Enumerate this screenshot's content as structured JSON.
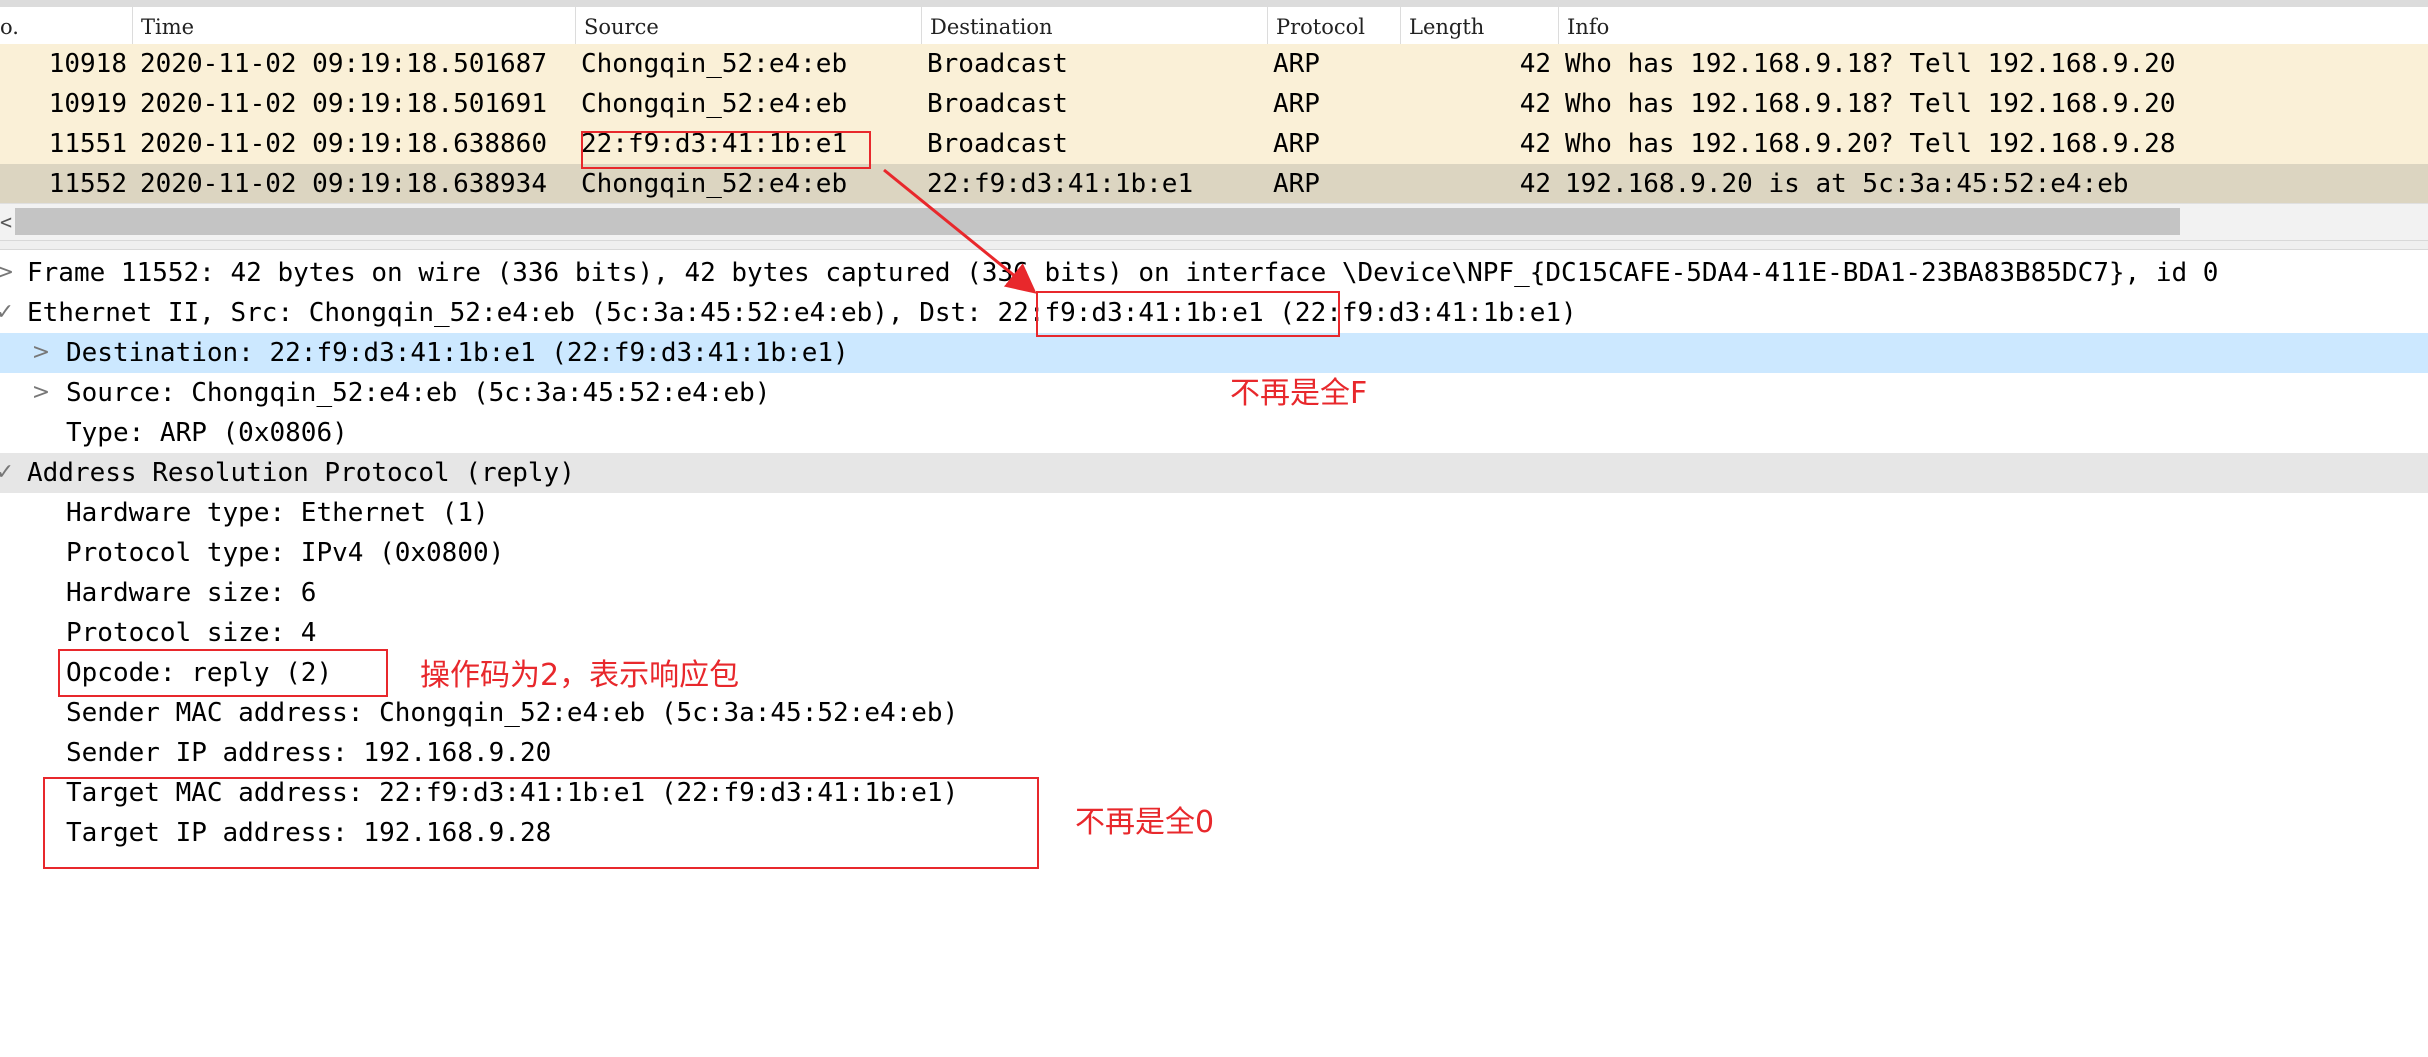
{
  "packet_list": {
    "columns": [
      "o.",
      "Time",
      "Source",
      "Destination",
      "Protocol",
      "Length",
      "Info"
    ],
    "rows": [
      {
        "no": "10918",
        "time": "2020-11-02 09:19:18.501687",
        "source": "Chongqin_52:e4:eb",
        "destination": "Broadcast",
        "protocol": "ARP",
        "length": "42",
        "info": "Who has 192.168.9.18? Tell 192.168.9.20"
      },
      {
        "no": "10919",
        "time": "2020-11-02 09:19:18.501691",
        "source": "Chongqin_52:e4:eb",
        "destination": "Broadcast",
        "protocol": "ARP",
        "length": "42",
        "info": "Who has 192.168.9.18? Tell 192.168.9.20"
      },
      {
        "no": "11551",
        "time": "2020-11-02 09:19:18.638860",
        "source": "22:f9:d3:41:1b:e1",
        "destination": "Broadcast",
        "protocol": "ARP",
        "length": "42",
        "info": "Who has 192.168.9.20? Tell 192.168.9.28"
      },
      {
        "no": "11552",
        "time": "2020-11-02 09:19:18.638934",
        "source": "Chongqin_52:e4:eb",
        "destination": "22:f9:d3:41:1b:e1",
        "protocol": "ARP",
        "length": "42",
        "info": "192.168.9.20 is at 5c:3a:45:52:e4:eb"
      }
    ],
    "scroll_left_glyph": "<"
  },
  "details": {
    "lines": [
      {
        "text": "Frame 11552: 42 bytes on wire (336 bits), 42 bytes captured (336 bits) on interface \\Device\\NPF_{DC15CAFE-5DA4-411E-BDA1-23BA83B85DC7}, id 0",
        "arrow": ">"
      },
      {
        "text": "Ethernet II, Src: Chongqin_52:e4:eb (5c:3a:45:52:e4:eb), Dst: 22:f9:d3:41:1b:e1 (22:f9:d3:41:1b:e1)",
        "arrow": "✓"
      },
      {
        "text": "Destination: 22:f9:d3:41:1b:e1 (22:f9:d3:41:1b:e1)",
        "arrow": ">"
      },
      {
        "text": "Source: Chongqin_52:e4:eb (5c:3a:45:52:e4:eb)",
        "arrow": ">"
      },
      {
        "text": "Type: ARP (0x0806)",
        "arrow": ""
      },
      {
        "text": "Address Resolution Protocol (reply)",
        "arrow": "✓"
      },
      {
        "text": "Hardware type: Ethernet (1)",
        "arrow": ""
      },
      {
        "text": "Protocol type: IPv4 (0x0800)",
        "arrow": ""
      },
      {
        "text": "Hardware size: 6",
        "arrow": ""
      },
      {
        "text": "Protocol size: 4",
        "arrow": ""
      },
      {
        "text": "Opcode: reply (2)",
        "arrow": ""
      },
      {
        "text": "Sender MAC address: Chongqin_52:e4:eb (5c:3a:45:52:e4:eb)",
        "arrow": ""
      },
      {
        "text": "Sender IP address: 192.168.9.20",
        "arrow": ""
      },
      {
        "text": "Target MAC address: 22:f9:d3:41:1b:e1 (22:f9:d3:41:1b:e1)",
        "arrow": ""
      },
      {
        "text": "Target IP address: 192.168.9.28",
        "arrow": ""
      }
    ]
  },
  "annotations": {
    "not_all_f": "不再是全F",
    "opcode_note": "操作码为2，表示响应包",
    "not_all_zero": "不再是全0"
  },
  "colors": {
    "row_bg": "#faf0d7",
    "row_selected_bg": "#dcd5c1",
    "detail_selected_bg": "#cce8ff",
    "annotation_red": "#e8282c"
  }
}
